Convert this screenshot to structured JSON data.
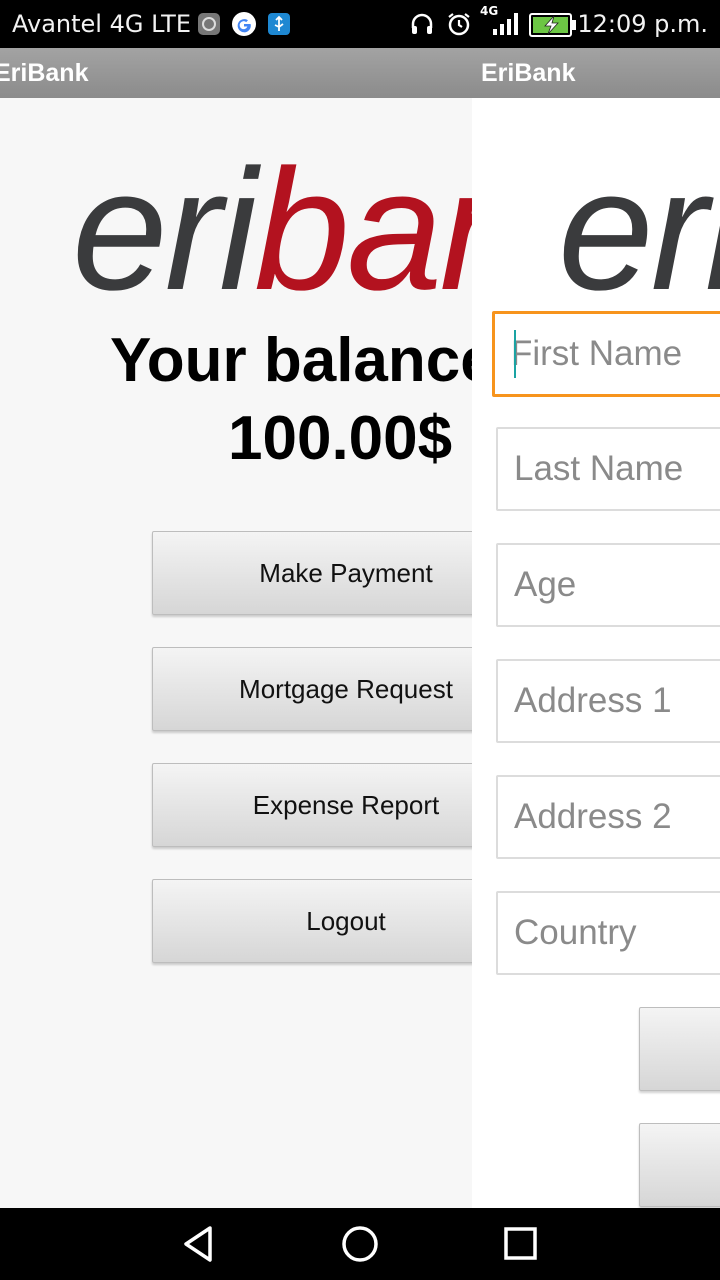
{
  "status_bar": {
    "carrier": "Avantel 4G LTE",
    "network_label": "4G",
    "time": "12:09 p.m."
  },
  "left_screen": {
    "title": "EriBank",
    "logo_text_dark": "eri",
    "logo_text_red": "ban",
    "balance_label": "Your balance",
    "balance_amount": "100.00$",
    "buttons": [
      {
        "label": "Make Payment"
      },
      {
        "label": "Mortgage Request"
      },
      {
        "label": "Expense Report"
      },
      {
        "label": "Logout"
      }
    ]
  },
  "right_screen": {
    "title": "EriBank",
    "logo_text": "eri",
    "fields": [
      {
        "placeholder": "First Name",
        "value": ""
      },
      {
        "placeholder": "Last Name",
        "value": ""
      },
      {
        "placeholder": "Age",
        "value": ""
      },
      {
        "placeholder": "Address 1",
        "value": ""
      },
      {
        "placeholder": "Address 2",
        "value": ""
      },
      {
        "placeholder": "Country",
        "value": ""
      }
    ]
  },
  "colors": {
    "brand_red": "#b3121f",
    "brand_dark": "#3a3b3d",
    "focus_orange": "#f7941d",
    "action_bar": "#999999"
  },
  "icons": [
    "headphones-icon",
    "alarm-icon",
    "signal-icon",
    "battery-charging-icon",
    "back-icon",
    "home-icon",
    "recents-icon"
  ]
}
